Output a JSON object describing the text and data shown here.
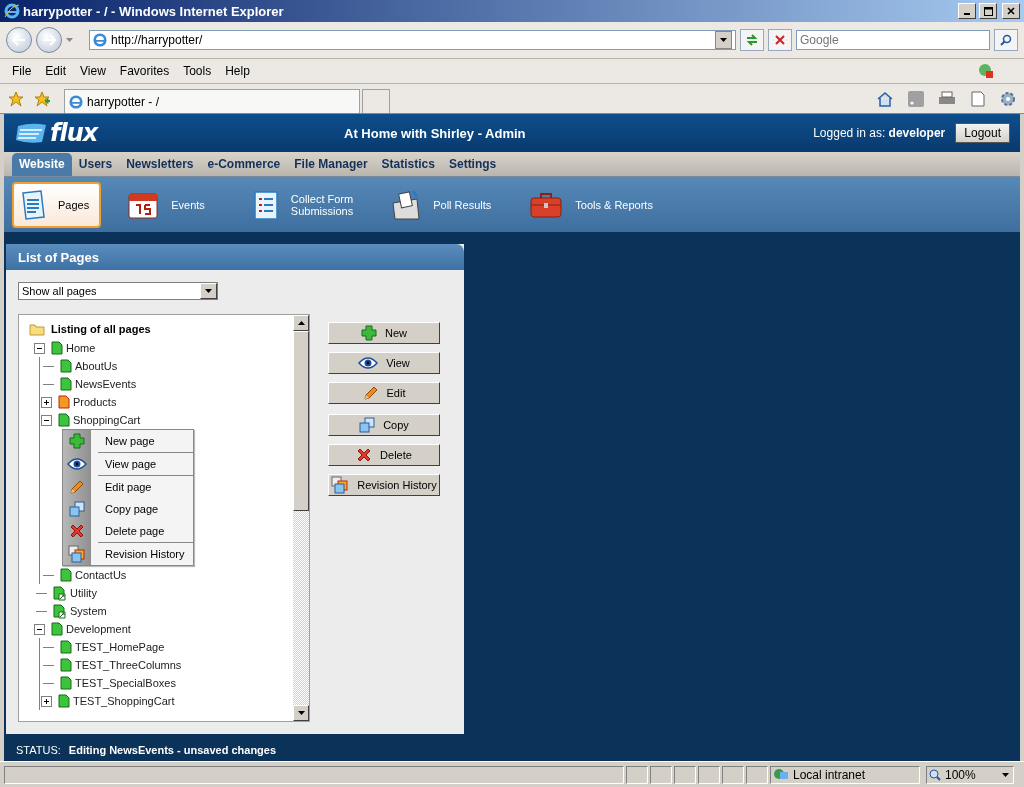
{
  "window": {
    "title": "harrypotter - / - Windows Internet Explorer"
  },
  "address_bar": {
    "value": "http://harrypotter/"
  },
  "search": {
    "placeholder": "Google"
  },
  "menu_bar": [
    "File",
    "Edit",
    "View",
    "Favorites",
    "Tools",
    "Help"
  ],
  "browser_tab": {
    "label": "harrypotter - /"
  },
  "app_header": {
    "logo": "flux",
    "title": "At Home with Shirley - Admin",
    "logged_in": "Logged in as: **developer**",
    "logout": "Logout"
  },
  "nav_tabs": [
    {
      "label": "Website",
      "selected": true
    },
    {
      "label": "Users",
      "selected": false
    },
    {
      "label": "Newsletters",
      "selected": false
    },
    {
      "label": "e-Commerce",
      "selected": false
    },
    {
      "label": "File Manager",
      "selected": false
    },
    {
      "label": "Statistics",
      "selected": false
    },
    {
      "label": "Settings",
      "selected": false
    }
  ],
  "sub_toolbar": [
    {
      "label": "Pages",
      "kind": "pages",
      "selected": true
    },
    {
      "label": "Events",
      "kind": "events",
      "selected": false
    },
    {
      "label": "Collect Form\nSubmissions",
      "kind": "form",
      "selected": false
    },
    {
      "label": "Poll Results",
      "kind": "poll",
      "selected": false
    },
    {
      "label": "Tools & Reports",
      "kind": "tools",
      "selected": false
    }
  ],
  "panel": {
    "title": "List of Pages",
    "filter": "Show all pages",
    "tree": {
      "root": "Listing of all pages",
      "children": [
        {
          "label": "Home",
          "kind": "page",
          "expanded": true,
          "children": [
            {
              "label": "AboutUs",
              "kind": "page"
            },
            {
              "label": "NewsEvents",
              "kind": "page"
            },
            {
              "label": "Products",
              "kind": "alert",
              "expanded": false
            },
            {
              "label": "ShoppingCart",
              "kind": "page",
              "expanded": true,
              "menu_open": true
            },
            {
              "label": "ContactUs",
              "kind": "page"
            }
          ]
        },
        {
          "label": "Utility",
          "kind": "shortcut"
        },
        {
          "label": "System",
          "kind": "shortcut"
        },
        {
          "label": "Development",
          "kind": "page",
          "expanded": true,
          "children": [
            {
              "label": "TEST_HomePage",
              "kind": "page"
            },
            {
              "label": "TEST_ThreeColumns",
              "kind": "page"
            },
            {
              "label": "TEST_SpecialBoxes",
              "kind": "page"
            },
            {
              "label": "TEST_ShoppingCart",
              "kind": "page",
              "expanded": false
            }
          ]
        }
      ]
    },
    "context_menu": [
      [
        {
          "label": "New page",
          "kind": "new"
        }
      ],
      [
        {
          "label": "View page",
          "kind": "view"
        }
      ],
      [
        {
          "label": "Edit page",
          "kind": "edit"
        },
        {
          "label": "Copy page",
          "kind": "copy"
        },
        {
          "label": "Delete page",
          "kind": "delete"
        }
      ],
      [
        {
          "label": "Revision History",
          "kind": "history"
        }
      ]
    ],
    "buttons": [
      {
        "label": "New",
        "kind": "new"
      },
      {
        "label": "View",
        "kind": "view"
      },
      {
        "label": "Edit",
        "kind": "edit"
      },
      {
        "label": "Copy",
        "kind": "copy"
      },
      {
        "label": "Delete",
        "kind": "delete"
      },
      {
        "label": "Revision History",
        "kind": "history"
      }
    ]
  },
  "status": {
    "label": "STATUS:",
    "message": "Editing NewsEvents - unsaved changes"
  },
  "status_bar": {
    "zone": "Local intranet",
    "zoom": "100%"
  }
}
